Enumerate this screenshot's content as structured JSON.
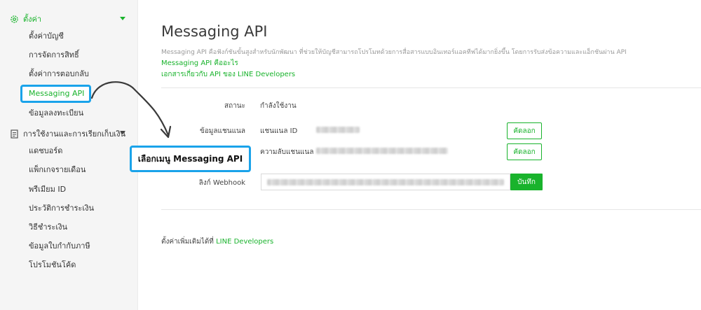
{
  "sidebar": {
    "settings_header": "ตั้งค่า",
    "settings_items": [
      {
        "label": "ตั้งค่าบัญชี"
      },
      {
        "label": "การจัดการสิทธิ์"
      },
      {
        "label": "ตั้งค่าการตอบกลับ"
      },
      {
        "label": "Messaging API"
      },
      {
        "label": "ข้อมูลลงทะเบียน"
      }
    ],
    "billing_header": "การใช้งานและการเรียกเก็บเงิน",
    "billing_items": [
      {
        "label": "แดชบอร์ด"
      },
      {
        "label": "แพ็กเกจรายเดือน"
      },
      {
        "label": "พรีเมียม ID"
      },
      {
        "label": "ประวัติการชำระเงิน"
      },
      {
        "label": "วิธีชำระเงิน"
      },
      {
        "label": "ข้อมูลใบกำกับภาษี"
      },
      {
        "label": "โปรโมชันโค้ด"
      }
    ]
  },
  "main": {
    "title": "Messaging API",
    "description": "Messaging API คือฟังก์ชันขั้นสูงสำหรับนักพัฒนา ที่ช่วยให้บัญชีสามารถโปรโมทด้วยการสื่อสารแบบอินเทอร์แอคทีฟได้มากยิ่งขึ้น โดยการรับส่งข้อความและแอ็กชันผ่าน API",
    "link_what": "Messaging API คืออะไร",
    "link_docs": "เอกสารเกี่ยวกับ API ของ LINE Developers",
    "status_label": "สถานะ",
    "status_value": "กำลังใช้งาน",
    "channel_label": "ข้อมูลแชนแนล",
    "channel_id_label": "แชนแนล ID",
    "channel_secret_label": "ความลับแชนแนล",
    "copy_label": "คัดลอก",
    "webhook_label": "ลิงก์ Webhook",
    "save_label": "บันทึก",
    "footer_text": "ตั้งค่าเพิ่มเติมได้ที่",
    "footer_link": "LINE Developers"
  },
  "callout": {
    "text": "เลือกเมนู Messaging API"
  },
  "colors": {
    "brand_green": "#19b32c",
    "highlight_blue": "#1aa3ea"
  },
  "icons": {
    "settings": "gear-icon",
    "billing": "document-icon",
    "expand": "caret-down-icon"
  }
}
